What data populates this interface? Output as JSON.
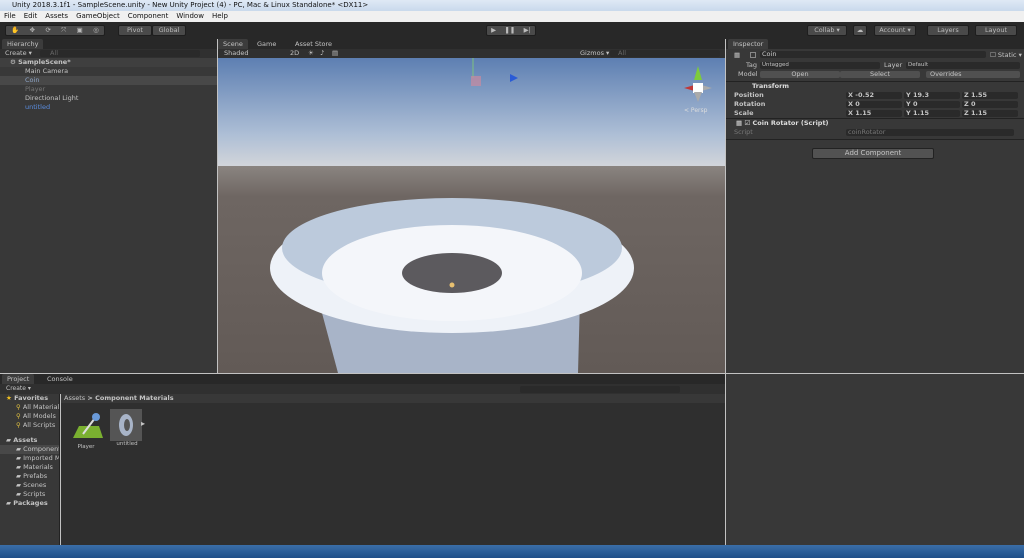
{
  "window": {
    "title": "Unity 2018.3.1f1 - SampleScene.unity - New Unity Project (4) - PC, Mac & Linux Standalone* <DX11>"
  },
  "menu": [
    "File",
    "Edit",
    "Assets",
    "GameObject",
    "Component",
    "Window",
    "Help"
  ],
  "toolbar": {
    "pivot": "Pivot",
    "global": "Global",
    "collab": "Collab ▾",
    "account": "Account ▾",
    "layers": "Layers",
    "layout": "Layout"
  },
  "hierarchy": {
    "tab": "Hierarchy",
    "create": "Create ▾",
    "search": "All",
    "scene": "SampleScene*",
    "items": [
      {
        "label": "Main Camera"
      },
      {
        "label": "Coin"
      },
      {
        "label": "Player"
      },
      {
        "label": "Directional Light"
      },
      {
        "label": "untitled"
      }
    ]
  },
  "scene": {
    "tabs": [
      "Scene",
      "Game",
      "Asset Store"
    ],
    "shading": "Shaded",
    "mode2d": "2D",
    "gizmos": "Gizmos ▾",
    "search": "All",
    "persp": "< Persp"
  },
  "inspector": {
    "tab": "Inspector",
    "object_name": "Coin",
    "static": "Static",
    "tag_label": "Tag",
    "tag": "Untagged",
    "layer_label": "Layer",
    "layer": "Default",
    "model_label": "Model",
    "open": "Open",
    "select": "Select",
    "overrides": "Overrides",
    "transform": {
      "title": "Transform",
      "rows": [
        {
          "label": "Position",
          "x": "X -0.52",
          "y": "Y 19.3",
          "z": "Z 1.55"
        },
        {
          "label": "Rotation",
          "x": "X 0",
          "y": "Y 0",
          "z": "Z 0"
        },
        {
          "label": "Scale",
          "x": "X 1.15",
          "y": "Y 1.15",
          "z": "Z 1.15"
        }
      ]
    },
    "script": {
      "title": "Coin Rotator (Script)",
      "label": "Script",
      "value": "coinRotator"
    },
    "add_component": "Add Component"
  },
  "project": {
    "tabs": [
      "Project",
      "Console"
    ],
    "create": "Create ▾",
    "favorites": "Favorites",
    "fav_items": [
      "All Materials",
      "All Models",
      "All Scripts"
    ],
    "assets": "Assets",
    "asset_folders": [
      "Component Materials",
      "Imported M",
      "Materials",
      "Prefabs",
      "Scenes",
      "Scripts"
    ],
    "packages": "Packages",
    "breadcrumb": [
      "Assets",
      "Component Materials"
    ],
    "files": [
      "Player",
      "untitled"
    ]
  }
}
